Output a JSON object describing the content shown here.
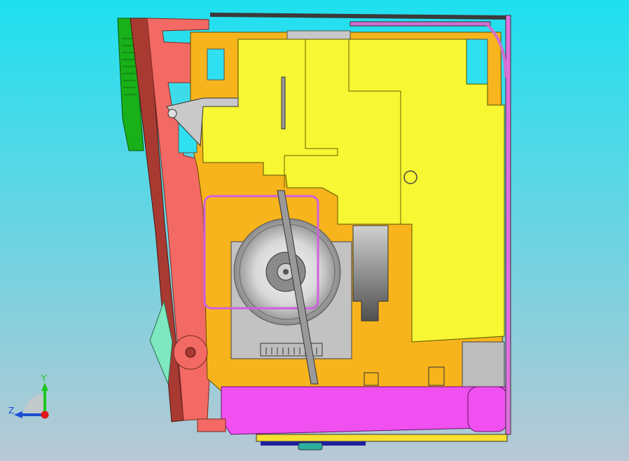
{
  "viewport": {
    "background_top": "#1ee0f0",
    "background_bottom": "#b8c8d4"
  },
  "triad": {
    "y_label": "Y",
    "z_label": "Z",
    "y_color": "#1fc61f",
    "z_color": "#1a4fd1",
    "x_color": "#e01818"
  },
  "parts": [
    {
      "name": "green-cover",
      "color": "#19b019"
    },
    {
      "name": "front-bezel",
      "color": "#a83a32"
    },
    {
      "name": "red-frame",
      "color": "#f26a63"
    },
    {
      "name": "orange-chassis",
      "color": "#f7b41c"
    },
    {
      "name": "yellow-board",
      "color": "#f7f733"
    },
    {
      "name": "gray-motor-plate",
      "color": "#c2c2c2"
    },
    {
      "name": "magenta-tray",
      "color": "#f050f0"
    },
    {
      "name": "pink-frame",
      "color": "#e070e0"
    },
    {
      "name": "dark-blue-rail",
      "color": "#1f1f9f"
    },
    {
      "name": "mint-flap",
      "color": "#7ee8c0"
    }
  ]
}
